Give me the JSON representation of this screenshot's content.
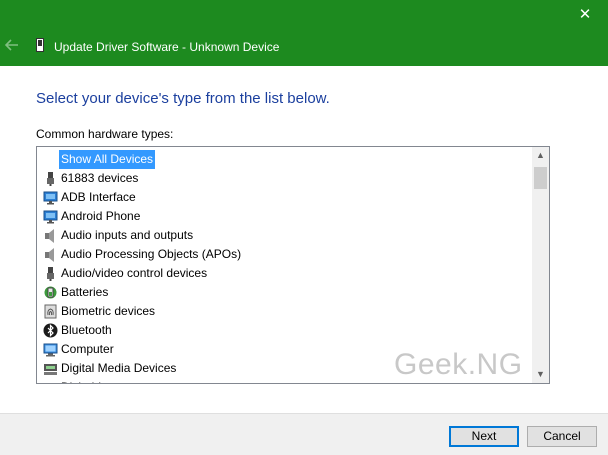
{
  "window": {
    "title": "Update Driver Software - Unknown Device",
    "close_glyph": "✕",
    "back_icon": "back-arrow-icon",
    "title_icon": "usb-device-icon"
  },
  "heading": "Select your device's type from the list below.",
  "list": {
    "label": "Common hardware types:",
    "selected_index": 0,
    "items": [
      {
        "label": "Show All Devices",
        "icon": "none"
      },
      {
        "label": "61883 devices",
        "icon": "usb-plug-icon"
      },
      {
        "label": "ADB Interface",
        "icon": "monitor-network-icon"
      },
      {
        "label": "Android Phone",
        "icon": "monitor-network-icon"
      },
      {
        "label": "Audio inputs and outputs",
        "icon": "speaker-icon"
      },
      {
        "label": "Audio Processing Objects (APOs)",
        "icon": "speaker-icon"
      },
      {
        "label": "Audio/video control devices",
        "icon": "usb-plug-icon"
      },
      {
        "label": "Batteries",
        "icon": "battery-icon"
      },
      {
        "label": "Biometric devices",
        "icon": "fingerprint-icon"
      },
      {
        "label": "Bluetooth",
        "icon": "bluetooth-icon"
      },
      {
        "label": "Computer",
        "icon": "computer-icon"
      },
      {
        "label": "Digital Media Devices",
        "icon": "media-device-icon"
      },
      {
        "label": "Disk drives",
        "icon": "disk-icon"
      }
    ]
  },
  "watermark": "Geek.NG",
  "buttons": {
    "next": "Next",
    "cancel": "Cancel"
  },
  "colors": {
    "titlebar": "#1d8a1f",
    "heading": "#1b3f9e",
    "selection": "#3399ff",
    "default_button_border": "#0078d7"
  }
}
